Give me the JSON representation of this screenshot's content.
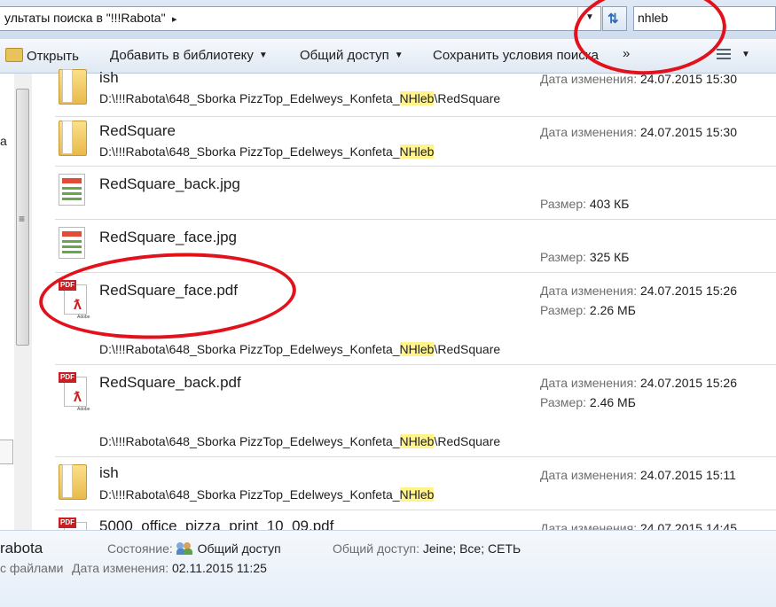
{
  "address_bar": {
    "path_text": "ультаты поиска в \"!!!Rabota\"",
    "separator": "▸",
    "dropdown_arrow": "▼",
    "refresh_icon": "refresh-arrows-icon"
  },
  "search": {
    "value": "nhleb"
  },
  "toolbar": {
    "open_label": "Открыть",
    "add_library_label": "Добавить в библиотеку",
    "share_label": "Общий доступ",
    "save_search_label": "Сохранить условия поиска",
    "more_label": "»",
    "dropdown_arrow": "▼"
  },
  "nav": {
    "fragment": "а",
    "grip": "≡"
  },
  "labels": {
    "date_modified": "Дата изменения:",
    "size": "Размер:"
  },
  "path_parts": {
    "before": "D:\\!!!Rabota\\648_Sborka PizzTop_Edelweys_Konfeta_",
    "highlight": "NHleb",
    "after": "\\RedSquare"
  },
  "items": [
    {
      "name": "ish",
      "type": "folder",
      "date": "24.07.2015 15:30"
    },
    {
      "name": "RedSquare",
      "type": "folder",
      "date": "24.07.2015 15:30"
    },
    {
      "name": "RedSquare_back.jpg",
      "type": "image",
      "size": "403 КБ"
    },
    {
      "name": "RedSquare_face.jpg",
      "type": "image",
      "size": "325 КБ"
    },
    {
      "name": "RedSquare_face.pdf",
      "type": "pdf",
      "date": "24.07.2015 15:26",
      "size": "2.26 МБ"
    },
    {
      "name": "RedSquare_back.pdf",
      "type": "pdf",
      "date": "24.07.2015 15:26",
      "size": "2.46 МБ"
    },
    {
      "name": "ish",
      "type": "folder",
      "date": "24.07.2015 15:11"
    },
    {
      "name": "5000_office_pizza_print_10_09.pdf",
      "type": "pdf",
      "date": "24.07.2015 14:45"
    }
  ],
  "icons": {
    "pdf_tag": "PDF",
    "pdf_brand": "Adobe",
    "pdf_swirl": "ƛ"
  },
  "details": {
    "name_fragment": "rabota",
    "type_fragment": "с файлами",
    "state_label": "Состояние:",
    "state_value": "Общий доступ",
    "shared_label": "Общий доступ:",
    "shared_value": "Jeine; Все; СЕТЬ",
    "date_label": "Дата изменения:",
    "date_value": "02.11.2015 11:25"
  },
  "colors": {
    "annotation": "#e2111c",
    "highlight": "#fff38a"
  }
}
